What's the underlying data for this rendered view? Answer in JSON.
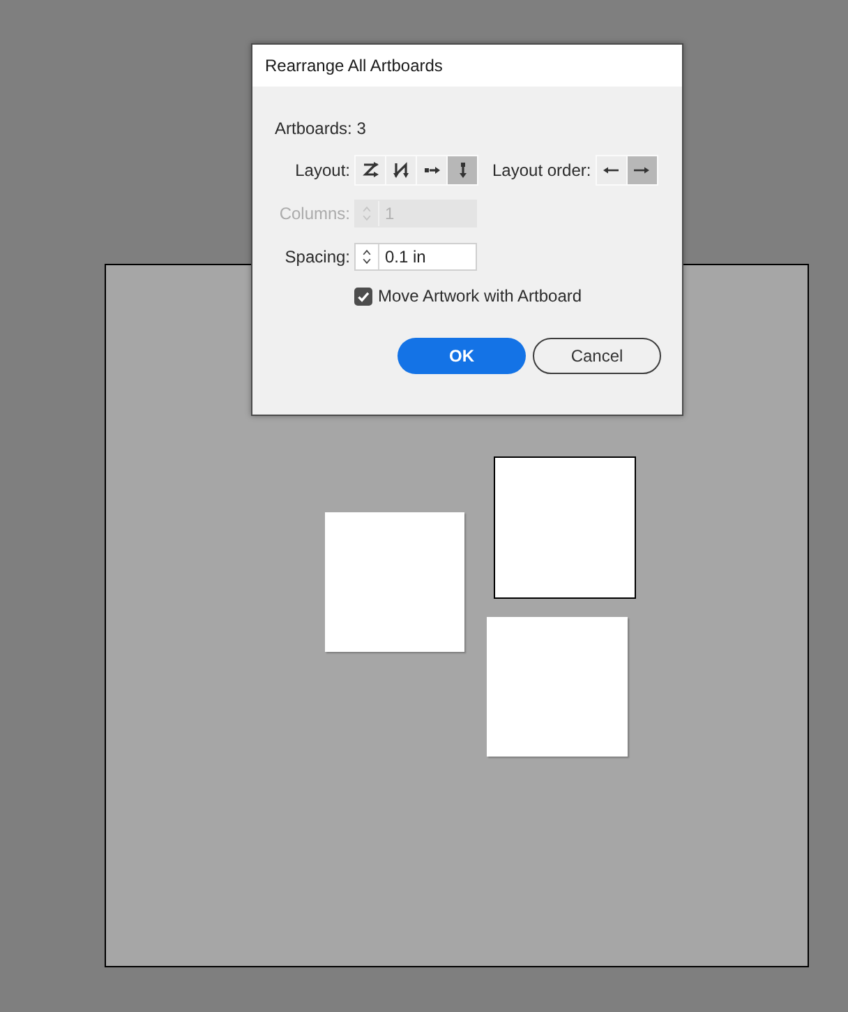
{
  "dialog": {
    "title": "Rearrange All Artboards",
    "artboards_text": "Artboards: 3",
    "layout": {
      "label": "Layout:",
      "options": [
        {
          "kind": "gridrow",
          "selected": false
        },
        {
          "kind": "gridcol",
          "selected": false
        },
        {
          "kind": "row",
          "selected": false
        },
        {
          "kind": "column",
          "selected": true
        }
      ]
    },
    "layout_order": {
      "label": "Layout order:",
      "options": [
        {
          "kind": "left",
          "selected": false
        },
        {
          "kind": "right",
          "selected": true
        }
      ]
    },
    "columns": {
      "label": "Columns:",
      "value": "1",
      "disabled": true
    },
    "spacing": {
      "label": "Spacing:",
      "value": "0.1 in",
      "disabled": false
    },
    "move_artwork": {
      "label": "Move Artwork with Artboard",
      "checked": true
    },
    "buttons": [
      {
        "label": "OK",
        "kind": "primary"
      },
      {
        "label": "Cancel",
        "kind": "secondary"
      }
    ]
  },
  "canvas": {
    "artboards": [
      {
        "selected": false
      },
      {
        "selected": true
      },
      {
        "selected": false
      }
    ]
  }
}
